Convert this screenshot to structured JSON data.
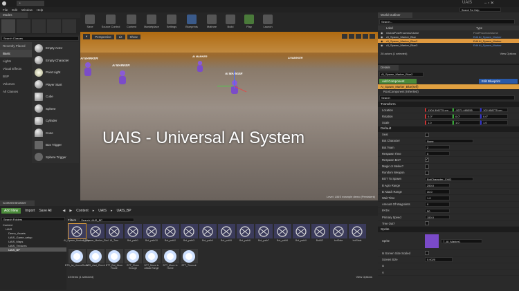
{
  "window": {
    "title": "UAIS",
    "search_placeholder": "Search For Help",
    "menu": [
      "File",
      "Edit",
      "Window",
      "Help"
    ]
  },
  "modes": {
    "label": "Modes"
  },
  "toolbar": [
    {
      "label": "Save"
    },
    {
      "label": "Source Control"
    },
    {
      "label": "Content"
    },
    {
      "label": "Marketplace"
    },
    {
      "label": "Settings"
    },
    {
      "label": "Blueprints"
    },
    {
      "label": "Matinee"
    },
    {
      "label": "Build"
    },
    {
      "label": "Play"
    },
    {
      "label": "Launch"
    }
  ],
  "place": {
    "search_placeholder": "Search Classes",
    "categories": [
      "Recently Placed",
      "Basic",
      "Lights",
      "Visual Effects",
      "BSP",
      "Volumes",
      "All Classes"
    ],
    "items": [
      "Empty Actor",
      "Empty Character",
      "Point Light",
      "Player Start",
      "Cube",
      "Sphere",
      "Cylinder",
      "Cone",
      "Box Trigger",
      "Sphere Trigger"
    ]
  },
  "viewport": {
    "buttons": [
      "Perspective",
      "Lit",
      "Show"
    ],
    "overlay": "UAIS - Universal AI System",
    "markers": [
      "AI MARKER",
      "AI MARKER",
      "AI MARKER",
      "AI MARKER",
      "AI MARKER"
    ],
    "level": "Level: UAIS example demo (Persistent)"
  },
  "content_browser": {
    "title": "Content Browser",
    "add_new": "Add New",
    "import": "Import",
    "save_all": "Save All",
    "path": [
      "Content",
      "UAIS",
      "UAIS_BP"
    ],
    "search_folders": "Search Folders",
    "filters": "Filters",
    "search_placeholder": "Search UAIS_BP",
    "tree": [
      "Content",
      "UAIS",
      "Demo_Assets",
      "UAIS_Game_setup",
      "UAIS_Maps",
      "UAIS_Textures",
      "UAIS_BP"
    ],
    "assets_row1": [
      "AI_Spawn_Marker_Blue",
      "AI_Spawn_Marker_Red",
      "AI_Tree",
      "Bot_path1",
      "Bot_path10",
      "Bot_path2",
      "Bot_path3",
      "Bot_path4",
      "Bot_path5",
      "Bot_path6",
      "Bot_path7",
      "Bot_path8",
      "Bot_path9",
      "BotAI2",
      "botData",
      "botStats"
    ],
    "assets_row2": [
      "BTD_Ist_UnoneRoute",
      "BTS_Assi_Check",
      "BTT_Bot_Move Route",
      "BTT_Close Enough",
      "BTT_Move to Attack Range",
      "BTT_Move to Home",
      "BTT_Timeout"
    ],
    "status": "23 items (1 selected)",
    "view_options": "View Options"
  },
  "outliner": {
    "title": "World Outliner",
    "search_placeholder": "Search...",
    "col_label": "Label",
    "col_type": "Type",
    "rows": [
      {
        "label": "GlobalPostProcessVolume",
        "type": "PostProcessVolume"
      },
      {
        "label": "AI_Spawn_Marker_Blue",
        "type": "Edit AI_Spawn_Marker"
      },
      {
        "label": "AI_Spawn_Marker_Blue2",
        "type": "Edit AI_Spawn_Marker"
      },
      {
        "label": "AI_Spawn_Marker_Blue3",
        "type": "Edit AI_Spawn_Marker"
      }
    ],
    "status": "28 actors (1 selected)",
    "view_options": "View Options"
  },
  "details": {
    "title": "Details",
    "name": "AI_Spawn_Marker_Blue2",
    "add_component": "Add Component",
    "edit_blueprint": "Edit Blueprint",
    "component_self": "AI_Spawn_Marker_Blue(self)",
    "root_component": "RootComponent (Inherited)",
    "search_placeholder": "Search",
    "transform": "Transform",
    "location": {
      "label": "Location",
      "x": "1304.306775 cm",
      "y": "-5271.465355",
      "z": "102.958775 cm"
    },
    "rotation": {
      "label": "Rotation",
      "x": "0.0°",
      "y": "0.0°",
      "z": "0.0°"
    },
    "scale": {
      "label": "Scale",
      "x": "1.0",
      "y": "1.0",
      "z": "1.0"
    },
    "default": "Default",
    "props": [
      {
        "k": "Seat",
        "type": "check",
        "v": ""
      },
      {
        "k": "Bot Character",
        "type": "select",
        "v": "None"
      },
      {
        "k": "Bot Team",
        "type": "input",
        "v": "2"
      },
      {
        "k": "Respawn Time",
        "type": "input",
        "v": "5"
      },
      {
        "k": "Respawn Bot?",
        "type": "check",
        "v": "✓"
      },
      {
        "k": "Magic or Melee?",
        "type": "check",
        "v": ""
      },
      {
        "k": "Random Weapon",
        "type": "check",
        "v": ""
      },
      {
        "k": "BOT To Spawn",
        "type": "select",
        "v": "BotCharacter_Ch02"
      },
      {
        "k": "B Agro Range",
        "type": "input",
        "v": "250.0"
      },
      {
        "k": "B Attack Range",
        "type": "input",
        "v": "30.0"
      },
      {
        "k": "Wait Time",
        "type": "input",
        "v": "1.0"
      },
      {
        "k": "Amount Of Waypoints",
        "type": "input",
        "v": "0"
      },
      {
        "k": "PATH",
        "type": "input",
        "v": "50"
      },
      {
        "k": "Primary Speed",
        "type": "input",
        "v": "150.0"
      },
      {
        "k": "Tree Out?",
        "type": "check",
        "v": ""
      }
    ],
    "sprite_section": "Sprite",
    "sprite_label": "Sprite",
    "sprite_value": "T_AI_Marker1",
    "screen_size_scaled": "Is Screen Size Scaled",
    "screen_size": "Screen Size",
    "screen_size_value": "0.0025",
    "u": "U",
    "v": "V"
  }
}
